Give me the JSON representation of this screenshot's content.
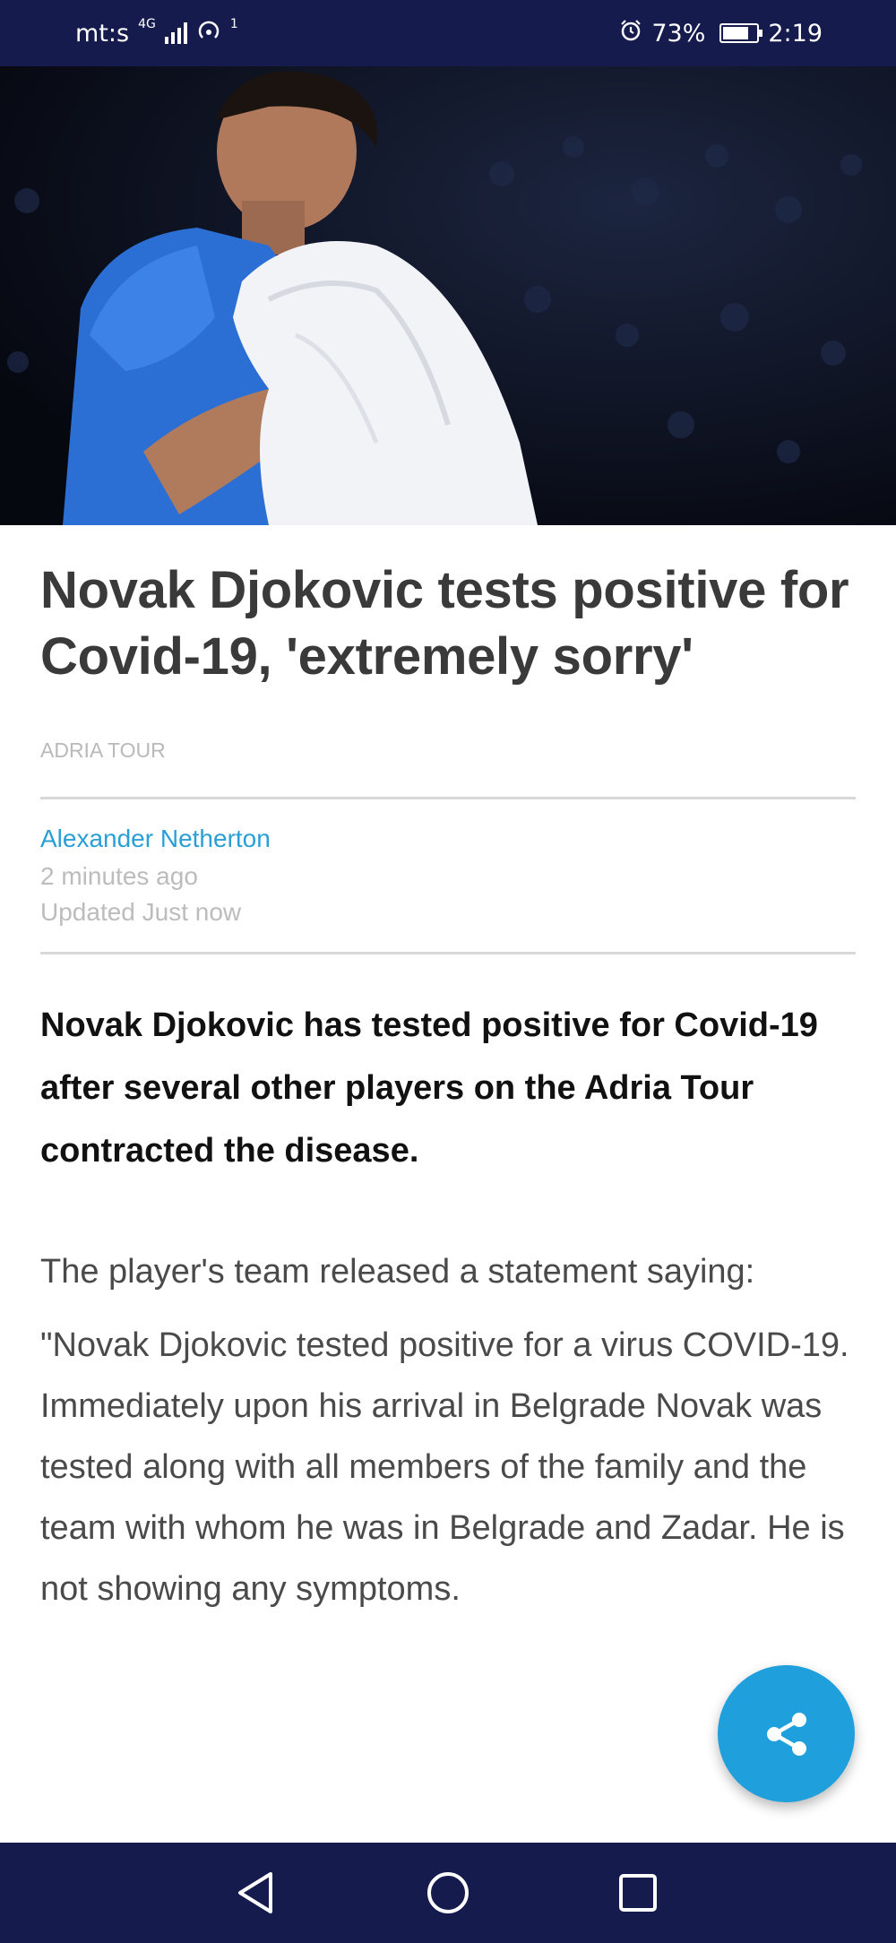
{
  "status_bar": {
    "carrier": "mt:s",
    "network": "4G",
    "hotspot_count": "1",
    "battery": "73%",
    "time": "2:19"
  },
  "article": {
    "headline": "Novak Djokovic tests positive for Covid-19, 'extremely sorry'",
    "category": "ADRIA TOUR",
    "author": "Alexander Netherton",
    "published": "2 minutes ago",
    "updated": "Updated Just now",
    "lead": "Novak Djokovic has tested positive for Covid-19 after several other players on the Adria Tour contracted the disease.",
    "paragraphs": [
      "The player's team released a statement saying:",
      "\"Novak Djokovic tested positive for a virus COVID-19. Immediately upon his arrival in Belgrade Novak was tested along with all members of the family and the team with whom he was in Belgrade and Zadar. He is not showing any symptoms."
    ]
  },
  "icons": {
    "share": "share-icon",
    "alarm": "alarm-icon",
    "back": "back-icon",
    "home": "home-icon",
    "recents": "recents-icon"
  },
  "colors": {
    "system_bar": "#161b4e",
    "accent": "#1f9fdc",
    "author": "#2a9fd6"
  }
}
